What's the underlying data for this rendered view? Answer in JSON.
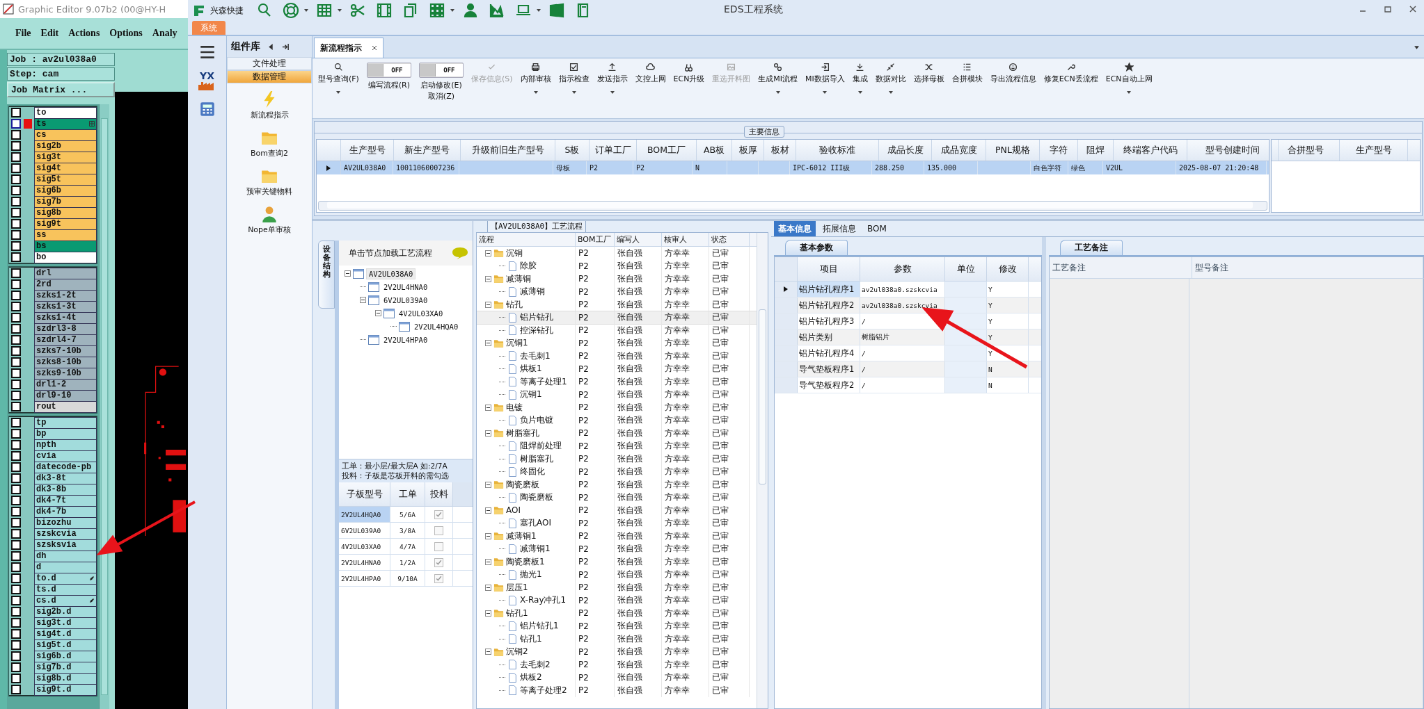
{
  "editor": {
    "title": "Graphic Editor 9.07b2 (00@HY-H",
    "menu": [
      "File",
      "Edit",
      "Actions",
      "Options",
      "Analy"
    ],
    "job": "Job : av2ul038a0",
    "step": "Step: cam",
    "matrix_button": "Job Matrix ...",
    "layer_groups": [
      {
        "layers": [
          {
            "name": "to",
            "color": "#ffffff",
            "active": false,
            "checked": false
          },
          {
            "name": "ts",
            "color": "#0a9a72",
            "active": true,
            "checked": false,
            "kind": "grid"
          },
          {
            "name": "cs",
            "color": "#f8c35c",
            "active": false,
            "checked": false
          },
          {
            "name": "sig2b",
            "color": "#f8c35c",
            "active": false,
            "checked": false
          },
          {
            "name": "sig3t",
            "color": "#f8c35c",
            "active": false,
            "checked": false
          },
          {
            "name": "sig4t",
            "color": "#f8c35c",
            "active": false,
            "checked": false
          },
          {
            "name": "sig5t",
            "color": "#f8c35c",
            "active": false,
            "checked": false
          },
          {
            "name": "sig6b",
            "color": "#f8c35c",
            "active": false,
            "checked": false
          },
          {
            "name": "sig7b",
            "color": "#f8c35c",
            "active": false,
            "checked": false
          },
          {
            "name": "sig8b",
            "color": "#f8c35c",
            "active": false,
            "checked": false
          },
          {
            "name": "sig9t",
            "color": "#f8c35c",
            "active": false,
            "checked": false
          },
          {
            "name": "ss",
            "color": "#f8c35c",
            "active": false,
            "checked": false
          },
          {
            "name": "bs",
            "color": "#0a9a72",
            "active": false,
            "checked": false
          },
          {
            "name": "bo",
            "color": "#ffffff",
            "active": false,
            "checked": false
          }
        ]
      },
      {
        "layers": [
          {
            "name": "drl",
            "color": "#9fb3bd",
            "active": false,
            "checked": false
          },
          {
            "name": "2rd",
            "color": "#9fb3bd",
            "active": false,
            "checked": false
          },
          {
            "name": "szks1-2t",
            "color": "#9fb3bd",
            "active": false,
            "checked": false
          },
          {
            "name": "szks1-3t",
            "color": "#9fb3bd",
            "active": false,
            "checked": false
          },
          {
            "name": "szks1-4t",
            "color": "#9fb3bd",
            "active": false,
            "checked": false
          },
          {
            "name": "szdrl3-8",
            "color": "#9fb3bd",
            "active": false,
            "checked": false
          },
          {
            "name": "szdrl4-7",
            "color": "#9fb3bd",
            "active": false,
            "checked": false
          },
          {
            "name": "szks7-10b",
            "color": "#9fb3bd",
            "active": false,
            "checked": false
          },
          {
            "name": "szks8-10b",
            "color": "#9fb3bd",
            "active": false,
            "checked": false
          },
          {
            "name": "szks9-10b",
            "color": "#9fb3bd",
            "active": false,
            "checked": false
          },
          {
            "name": "drl1-2",
            "color": "#9fb3bd",
            "active": false,
            "checked": false
          },
          {
            "name": "drl9-10",
            "color": "#9fb3bd",
            "active": false,
            "checked": false
          },
          {
            "name": "rout",
            "color": "#d9d9d9",
            "active": false,
            "checked": false
          }
        ]
      },
      {
        "layers": [
          {
            "name": "tp",
            "color": "#a2dcdc",
            "active": false,
            "checked": false
          },
          {
            "name": "bp",
            "color": "#a2dcdc",
            "active": false,
            "checked": false
          },
          {
            "name": "npth",
            "color": "#a2dcdc",
            "active": false,
            "checked": false
          },
          {
            "name": "cvia",
            "color": "#a2dcdc",
            "active": false,
            "checked": false
          },
          {
            "name": "datecode-pb",
            "color": "#a2dcdc",
            "active": false,
            "checked": false
          },
          {
            "name": "dk3-8t",
            "color": "#a2dcdc",
            "active": false,
            "checked": false
          },
          {
            "name": "dk3-8b",
            "color": "#a2dcdc",
            "active": false,
            "checked": false
          },
          {
            "name": "dk4-7t",
            "color": "#a2dcdc",
            "active": false,
            "checked": false
          },
          {
            "name": "dk4-7b",
            "color": "#a2dcdc",
            "active": false,
            "checked": false
          },
          {
            "name": "bizozhu",
            "color": "#a2dcdc",
            "active": false,
            "checked": false
          },
          {
            "name": "szskcvia",
            "color": "#a2dcdc",
            "active": false,
            "checked": false
          },
          {
            "name": "szsksvia",
            "color": "#a2dcdc",
            "active": false,
            "checked": false
          },
          {
            "name": "dh",
            "color": "#a2dcdc",
            "active": false,
            "checked": false
          },
          {
            "name": "d",
            "color": "#a2dcdc",
            "active": false,
            "checked": false
          },
          {
            "name": "to.d",
            "color": "#a2dcdc",
            "active": false,
            "checked": false,
            "kind": "pen"
          },
          {
            "name": "ts.d",
            "color": "#a2dcdc",
            "active": false,
            "checked": false
          },
          {
            "name": "cs.d",
            "color": "#a2dcdc",
            "active": false,
            "checked": false,
            "kind": "pen"
          },
          {
            "name": "sig2b.d",
            "color": "#a2dcdc",
            "active": false,
            "checked": false
          },
          {
            "name": "sig3t.d",
            "color": "#a2dcdc",
            "active": false,
            "checked": false
          },
          {
            "name": "sig4t.d",
            "color": "#a2dcdc",
            "active": false,
            "checked": false
          },
          {
            "name": "sig5t.d",
            "color": "#a2dcdc",
            "active": false,
            "checked": false
          },
          {
            "name": "sig6b.d",
            "color": "#a2dcdc",
            "active": false,
            "checked": false
          },
          {
            "name": "sig7b.d",
            "color": "#a2dcdc",
            "active": false,
            "checked": false
          },
          {
            "name": "sig8b.d",
            "color": "#a2dcdc",
            "active": false,
            "checked": false
          },
          {
            "name": "sig9t.d",
            "color": "#a2dcdc",
            "active": false,
            "checked": false
          }
        ]
      }
    ]
  },
  "app": {
    "brand": "兴森快捷",
    "title": "EDS工程系统",
    "system_tab": "系统",
    "nav_logo": "YX"
  },
  "library": {
    "title": "组件库",
    "categories": [
      {
        "label": "文件处理",
        "selected": false
      },
      {
        "label": "数据管理",
        "selected": true
      }
    ],
    "items": [
      "新流程指示",
      "Bom查询2",
      "预审关键物料",
      "Nope单审核"
    ]
  },
  "doc_tabs": [
    {
      "label": "新流程指示",
      "selected": true
    }
  ],
  "toolbar": [
    {
      "kind": "button",
      "label": "型号查询(F)",
      "dropdown": true,
      "disabled": false
    },
    {
      "kind": "toggle",
      "toggle": "OFF",
      "label": "编写流程(R)",
      "on": false
    },
    {
      "kind": "toggle",
      "toggle": "OFF",
      "label": "启动修改(E)",
      "sub": "取消(Z)",
      "on": false
    },
    {
      "kind": "button",
      "label": "保存信息(S)",
      "dropdown": false,
      "disabled": true
    },
    {
      "kind": "button",
      "label": "内部审核",
      "dropdown": true,
      "disabled": false
    },
    {
      "kind": "button",
      "label": "指示检查",
      "dropdown": true,
      "disabled": false
    },
    {
      "kind": "button",
      "label": "发送指示",
      "dropdown": true,
      "disabled": false
    },
    {
      "kind": "button",
      "label": "文控上网",
      "dropdown": false,
      "disabled": false
    },
    {
      "kind": "button",
      "label": "ECN升级",
      "dropdown": false,
      "disabled": false
    },
    {
      "kind": "button",
      "label": "重选开料图",
      "dropdown": false,
      "disabled": true
    },
    {
      "kind": "button",
      "label": "生成MI流程",
      "dropdown": true,
      "disabled": false
    },
    {
      "kind": "button",
      "label": "MI数据导入",
      "dropdown": true,
      "disabled": false
    },
    {
      "kind": "button",
      "label": "集成",
      "dropdown": true,
      "disabled": false
    },
    {
      "kind": "button",
      "label": "数据对比",
      "dropdown": true,
      "disabled": false
    },
    {
      "kind": "button",
      "label": "选择母板",
      "dropdown": false,
      "disabled": false
    },
    {
      "kind": "button",
      "label": "合拼模块",
      "dropdown": false,
      "disabled": false
    },
    {
      "kind": "button",
      "label": "导出流程信息",
      "dropdown": false,
      "disabled": false
    },
    {
      "kind": "button",
      "label": "修复ECN丢流程",
      "dropdown": false,
      "disabled": false
    },
    {
      "kind": "button",
      "label": "ECN自动上网",
      "dropdown": true,
      "disabled": false
    }
  ],
  "main_info": {
    "title": "主要信息",
    "columns": [
      "生产型号",
      "新生产型号",
      "升级前旧生产型号",
      "S板",
      "订单工厂",
      "BOM工厂",
      "AB板",
      "板厚",
      "板材",
      "验收标准",
      "成品长度",
      "成品宽度",
      "PNL规格",
      "字符",
      "阻焊",
      "终端客户代码",
      "型号创建时间"
    ],
    "rows": [
      {
        "selected": true,
        "cells": [
          "AV2UL038A0",
          "10011060007236",
          null,
          "母板",
          "P2",
          "P2",
          "N",
          null,
          null,
          "IPC-6012 III级",
          "288.250",
          "135.000",
          null,
          "白色字符",
          "绿色",
          "V2UL",
          "2025-08-07 21:20:48"
        ]
      }
    ],
    "merge_columns": [
      "合拼型号",
      "生产型号"
    ]
  },
  "structure": {
    "side_tab": "设备结构",
    "hint": "单击节点加载工艺流程",
    "tree": [
      {
        "label": "AV2UL038A0",
        "selected": true,
        "expanded": true,
        "children": [
          {
            "label": "2V2UL4HNA0",
            "selected": false
          },
          {
            "label": "6V2UL039A0",
            "selected": false,
            "expanded": true,
            "children": [
              {
                "label": "4V2UL03XA0",
                "selected": false,
                "expanded": true,
                "children": [
                  {
                    "label": "2V2UL4HQA0",
                    "selected": false
                  }
                ]
              }
            ]
          },
          {
            "label": "2V2UL4HPA0",
            "selected": false
          }
        ]
      }
    ],
    "notes": [
      "工单：最小层/最大层A 如:2/7A",
      "投料：子板是芯板开料的需勾选"
    ],
    "columns": [
      "子板型号",
      "工单",
      "投料"
    ],
    "rows": [
      {
        "model": "2V2UL4HQA0",
        "order": "5/6A",
        "checked": true,
        "selected": true
      },
      {
        "model": "6V2UL039A0",
        "order": "3/8A",
        "checked": false,
        "selected": false
      },
      {
        "model": "4V2UL03XA0",
        "order": "4/7A",
        "checked": false,
        "selected": false
      },
      {
        "model": "2V2UL4HNA0",
        "order": "1/2A",
        "checked": true,
        "selected": false
      },
      {
        "model": "2V2UL4HPA0",
        "order": "9/10A",
        "checked": true,
        "selected": false
      }
    ]
  },
  "flow": {
    "title": "【AV2UL038A0】工艺流程",
    "columns": [
      "流程",
      "BOM工厂",
      "编写人",
      "核审人",
      "状态"
    ],
    "steps": [
      {
        "name": "沉铜",
        "bom": "P2",
        "writer": "张自强",
        "reviewer": "方幸幸",
        "status": "已审",
        "selected": false,
        "expanded": true,
        "children": [
          {
            "name": "除胶",
            "bom": "P2",
            "writer": "张自强",
            "reviewer": "方幸幸",
            "status": "已审",
            "selected": false
          }
        ]
      },
      {
        "name": "减薄铜",
        "bom": "P2",
        "writer": "张自强",
        "reviewer": "方幸幸",
        "status": "已审",
        "selected": false,
        "expanded": true,
        "children": [
          {
            "name": "减薄铜",
            "bom": "P2",
            "writer": "张自强",
            "reviewer": "方幸幸",
            "status": "已审",
            "selected": false
          }
        ]
      },
      {
        "name": "钻孔",
        "bom": "P2",
        "writer": "张自强",
        "reviewer": "方幸幸",
        "status": "已审",
        "selected": false,
        "expanded": true,
        "children": [
          {
            "name": "铝片钻孔",
            "bom": "P2",
            "writer": "张自强",
            "reviewer": "方幸幸",
            "status": "已审",
            "selected": true
          },
          {
            "name": "控深钻孔",
            "bom": "P2",
            "writer": "张自强",
            "reviewer": "方幸幸",
            "status": "已审",
            "selected": false
          }
        ]
      },
      {
        "name": "沉铜1",
        "bom": "P2",
        "writer": "张自强",
        "reviewer": "方幸幸",
        "status": "已审",
        "selected": false,
        "expanded": true,
        "children": [
          {
            "name": "去毛刺1",
            "bom": "P2",
            "writer": "张自强",
            "reviewer": "方幸幸",
            "status": "已审",
            "selected": false
          },
          {
            "name": "烘板1",
            "bom": "P2",
            "writer": "张自强",
            "reviewer": "方幸幸",
            "status": "已审",
            "selected": false
          },
          {
            "name": "等离子处理1",
            "bom": "P2",
            "writer": "张自强",
            "reviewer": "方幸幸",
            "status": "已审",
            "selected": false
          },
          {
            "name": "沉铜1",
            "bom": "P2",
            "writer": "张自强",
            "reviewer": "方幸幸",
            "status": "已审",
            "selected": false
          }
        ]
      },
      {
        "name": "电镀",
        "bom": "P2",
        "writer": "张自强",
        "reviewer": "方幸幸",
        "status": "已审",
        "selected": false,
        "expanded": true,
        "children": [
          {
            "name": "负片电镀",
            "bom": "P2",
            "writer": "张自强",
            "reviewer": "方幸幸",
            "status": "已审",
            "selected": false
          }
        ]
      },
      {
        "name": "树脂塞孔",
        "bom": "P2",
        "writer": "张自强",
        "reviewer": "方幸幸",
        "status": "已审",
        "selected": false,
        "expanded": true,
        "children": [
          {
            "name": "阻焊前处理",
            "bom": "P2",
            "writer": "张自强",
            "reviewer": "方幸幸",
            "status": "已审",
            "selected": false
          },
          {
            "name": "树脂塞孔",
            "bom": "P2",
            "writer": "张自强",
            "reviewer": "方幸幸",
            "status": "已审",
            "selected": false
          },
          {
            "name": "终固化",
            "bom": "P2",
            "writer": "张自强",
            "reviewer": "方幸幸",
            "status": "已审",
            "selected": false
          }
        ]
      },
      {
        "name": "陶瓷磨板",
        "bom": "P2",
        "writer": "张自强",
        "reviewer": "方幸幸",
        "status": "已审",
        "selected": false,
        "expanded": true,
        "children": [
          {
            "name": "陶瓷磨板",
            "bom": "P2",
            "writer": "张自强",
            "reviewer": "方幸幸",
            "status": "已审",
            "selected": false
          }
        ]
      },
      {
        "name": "AOI",
        "bom": "P2",
        "writer": "张自强",
        "reviewer": "方幸幸",
        "status": "已审",
        "selected": false,
        "expanded": true,
        "children": [
          {
            "name": "塞孔AOI",
            "bom": "P2",
            "writer": "张自强",
            "reviewer": "方幸幸",
            "status": "已审",
            "selected": false
          }
        ]
      },
      {
        "name": "减薄铜1",
        "bom": "P2",
        "writer": "张自强",
        "reviewer": "方幸幸",
        "status": "已审",
        "selected": false,
        "expanded": true,
        "children": [
          {
            "name": "减薄铜1",
            "bom": "P2",
            "writer": "张自强",
            "reviewer": "方幸幸",
            "status": "已审",
            "selected": false
          }
        ]
      },
      {
        "name": "陶瓷磨板1",
        "bom": "P2",
        "writer": "张自强",
        "reviewer": "方幸幸",
        "status": "已审",
        "selected": false,
        "expanded": true,
        "children": [
          {
            "name": "抛光1",
            "bom": "P2",
            "writer": "张自强",
            "reviewer": "方幸幸",
            "status": "已审",
            "selected": false
          }
        ]
      },
      {
        "name": "层压1",
        "bom": "P2",
        "writer": "张自强",
        "reviewer": "方幸幸",
        "status": "已审",
        "selected": false,
        "expanded": true,
        "children": [
          {
            "name": "X-Ray冲孔1",
            "bom": "P2",
            "writer": "张自强",
            "reviewer": "方幸幸",
            "status": "已审",
            "selected": false
          }
        ]
      },
      {
        "name": "钻孔1",
        "bom": "P2",
        "writer": "张自强",
        "reviewer": "方幸幸",
        "status": "已审",
        "selected": false,
        "expanded": true,
        "children": [
          {
            "name": "铝片钻孔1",
            "bom": "P2",
            "writer": "张自强",
            "reviewer": "方幸幸",
            "status": "已审",
            "selected": false
          },
          {
            "name": "钻孔1",
            "bom": "P2",
            "writer": "张自强",
            "reviewer": "方幸幸",
            "status": "已审",
            "selected": false
          }
        ]
      },
      {
        "name": "沉铜2",
        "bom": "P2",
        "writer": "张自强",
        "reviewer": "方幸幸",
        "status": "已审",
        "selected": false,
        "expanded": true,
        "children": [
          {
            "name": "去毛刺2",
            "bom": "P2",
            "writer": "张自强",
            "reviewer": "方幸幸",
            "status": "已审",
            "selected": false
          },
          {
            "name": "烘板2",
            "bom": "P2",
            "writer": "张自强",
            "reviewer": "方幸幸",
            "status": "已审",
            "selected": false
          },
          {
            "name": "等离子处理2",
            "bom": "P2",
            "writer": "张自强",
            "reviewer": "方幸幸",
            "status": "已审",
            "selected": false
          }
        ]
      }
    ]
  },
  "details": {
    "tabs": [
      {
        "label": "基本信息",
        "selected": true
      },
      {
        "label": "拓展信息",
        "selected": false
      },
      {
        "label": "BOM",
        "selected": false
      }
    ],
    "param_tab": "基本参数",
    "columns": [
      "项目",
      "参数",
      "单位",
      "修改"
    ],
    "rows": [
      {
        "item": "铝片钻孔程序1",
        "value": "av2ul038a0.szskcvia",
        "modify": "Y",
        "selected": true
      },
      {
        "item": "铝片钻孔程序2",
        "value": "av2ul038a0.szskcvia",
        "modify": "Y",
        "selected": false
      },
      {
        "item": "铝片钻孔程序3",
        "value": "/",
        "modify": "Y",
        "selected": false
      },
      {
        "item": "铝片类别",
        "value": "树脂铝片",
        "modify": "Y",
        "selected": false
      },
      {
        "item": "铝片钻孔程序4",
        "value": "/",
        "modify": "Y",
        "selected": false
      },
      {
        "item": "导气垫板程序1",
        "value": "/",
        "modify": "N",
        "selected": false
      },
      {
        "item": "导气垫板程序2",
        "value": "/",
        "modify": "N",
        "selected": false
      }
    ],
    "remark_tab": "工艺备注",
    "remark_columns": [
      "工艺备注",
      "型号备注"
    ]
  }
}
